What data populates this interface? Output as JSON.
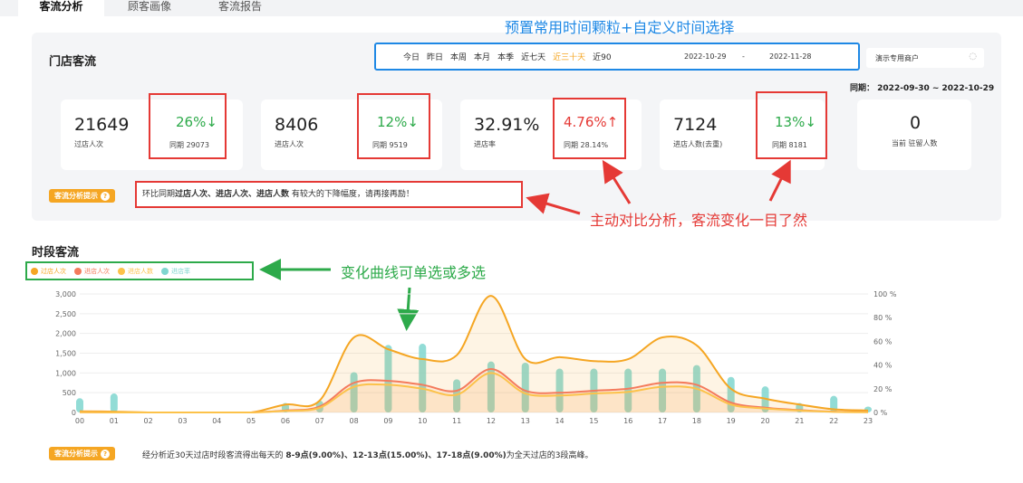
{
  "tabs": [
    {
      "label": "客流分析",
      "active": true
    },
    {
      "label": "顾客画像",
      "active": false
    },
    {
      "label": "客流报告",
      "active": false
    }
  ],
  "annotations": {
    "top": "预置常用时间颗粒+自定义时间选择",
    "compare": "主动对比分析，客流变化一目了然",
    "curves": "变化曲线可单选或多选"
  },
  "store_traffic": {
    "title": "门店客流",
    "range_options": [
      "今日",
      "昨日",
      "本周",
      "本月",
      "本季",
      "近七天",
      "近三十天",
      "近90天"
    ],
    "selected_range": "近三十天",
    "date_start": "2022-10-29",
    "date_sep": "-",
    "date_end": "2022-11-28",
    "merchant": "演示专用商户",
    "same_period_label": "同期：",
    "same_period_range": "2022-09-30 ~ 2022-10-29",
    "cards": [
      {
        "value": "21649",
        "label": "过店人次",
        "change": "26%↓",
        "change_dir": "down",
        "compare": "同期 29073"
      },
      {
        "value": "8406",
        "label": "进店人次",
        "change": "12%↓",
        "change_dir": "down",
        "compare": "同期 9519"
      },
      {
        "value": "32.91%",
        "label": "进店率",
        "change": "4.76%↑",
        "change_dir": "up",
        "compare": "同期 28.14%"
      },
      {
        "value": "7124",
        "label": "进店人数(去重)",
        "change": "13%↓",
        "change_dir": "down",
        "compare": "同期 8181"
      }
    ],
    "current_card": {
      "value": "0",
      "label": "当前 驻留人数"
    },
    "tip_badge": "客流分析提示",
    "tip_icon": "question-icon",
    "tip_text_prefix": "环比同期",
    "tip_text_bold": "过店人次、进店人次、进店人数",
    "tip_text_suffix": " 有较大的下降幅度，请再接再励！"
  },
  "time_traffic": {
    "title": "时段客流",
    "legend": [
      {
        "label": "过店人次",
        "color": "#f5a623"
      },
      {
        "label": "进店人次",
        "color": "#f47b5c"
      },
      {
        "label": "进店人数",
        "color": "#fcc24a"
      },
      {
        "label": "进店率",
        "color": "#7fd6cf"
      }
    ],
    "tip_badge": "客流分析提示",
    "tip_text_prefix": "经分析近30天过店时段客流得出每天的 ",
    "tip_text_bold": "8-9点(9.00%)、12-13点(15.00%)、17-18点(9.00%)",
    "tip_text_suffix": "为全天过店的3段高峰。"
  },
  "chart_data": {
    "type": "line",
    "x": [
      "00",
      "01",
      "02",
      "03",
      "04",
      "05",
      "06",
      "07",
      "08",
      "09",
      "10",
      "11",
      "12",
      "13",
      "14",
      "15",
      "16",
      "17",
      "18",
      "19",
      "20",
      "21",
      "22",
      "23"
    ],
    "y_left_ticks": [
      "0",
      "500",
      "1,000",
      "1,500",
      "2,000",
      "2,500",
      "3,000"
    ],
    "y_right_ticks": [
      "0 %",
      "20 %",
      "40 %",
      "60 %",
      "80 %",
      "100 %"
    ],
    "ylim_left": [
      0,
      3000
    ],
    "ylim_right": [
      0,
      100
    ],
    "series": [
      {
        "name": "过店人次",
        "color": "#f5a623",
        "values": [
          30,
          20,
          0,
          0,
          0,
          0,
          200,
          300,
          1900,
          1600,
          1350,
          1450,
          2950,
          1350,
          1400,
          1300,
          1350,
          1900,
          1700,
          600,
          350,
          200,
          80,
          50
        ]
      },
      {
        "name": "进店人次",
        "color": "#f47b5c",
        "values": [
          5,
          0,
          0,
          0,
          0,
          0,
          50,
          150,
          750,
          800,
          700,
          550,
          1100,
          550,
          500,
          550,
          600,
          750,
          700,
          250,
          120,
          60,
          20,
          10
        ]
      },
      {
        "name": "进店人数",
        "color": "#fcc24a",
        "values": [
          5,
          0,
          0,
          0,
          0,
          0,
          40,
          120,
          650,
          700,
          600,
          450,
          1000,
          480,
          430,
          480,
          520,
          650,
          600,
          200,
          100,
          50,
          15,
          5
        ]
      },
      {
        "name": "进店率",
        "color": "#7fd6cf",
        "axis": "right",
        "values": [
          12,
          16,
          0,
          0,
          0,
          0,
          8,
          10,
          34,
          57,
          58,
          28,
          43,
          42,
          37,
          37,
          37,
          37,
          40,
          30,
          22,
          8,
          14,
          5
        ]
      }
    ]
  }
}
